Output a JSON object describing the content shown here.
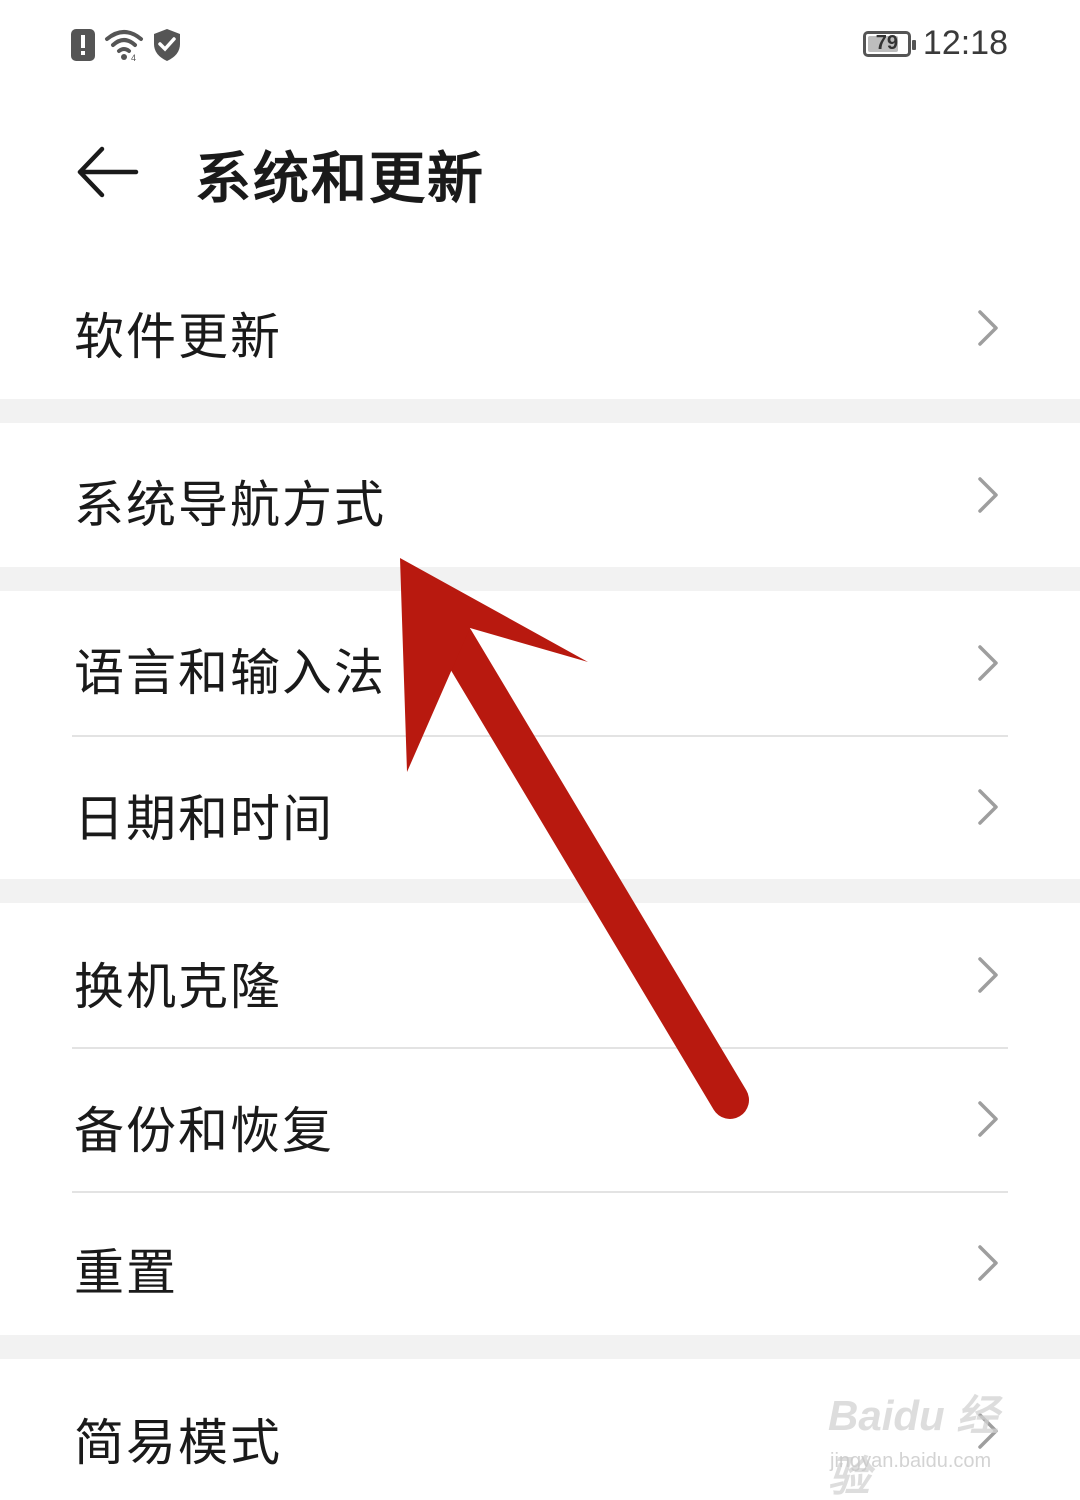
{
  "status_bar": {
    "time": "12:18",
    "battery_level": 79,
    "battery_text": "79",
    "icons": [
      "alert-icon",
      "wifi-icon",
      "shield-icon"
    ]
  },
  "header": {
    "title": "系统和更新",
    "back_icon": "arrow-left-icon"
  },
  "menu": {
    "items": [
      {
        "label": "软件更新"
      },
      {
        "label": "系统导航方式"
      },
      {
        "label": "语言和输入法"
      },
      {
        "label": "日期和时间"
      },
      {
        "label": "换机克隆"
      },
      {
        "label": "备份和恢复"
      },
      {
        "label": "重置"
      },
      {
        "label": "简易模式"
      }
    ]
  },
  "annotation": {
    "color": "#b8190f",
    "points_to": "系统导航方式"
  },
  "watermark": {
    "brand": "Baidu 经验",
    "url": "jingyan.baidu.com"
  },
  "colors": {
    "background": "#ffffff",
    "group_gap": "#f2f2f2",
    "divider": "#e3e3e3",
    "chevron": "#9e9e9e"
  }
}
